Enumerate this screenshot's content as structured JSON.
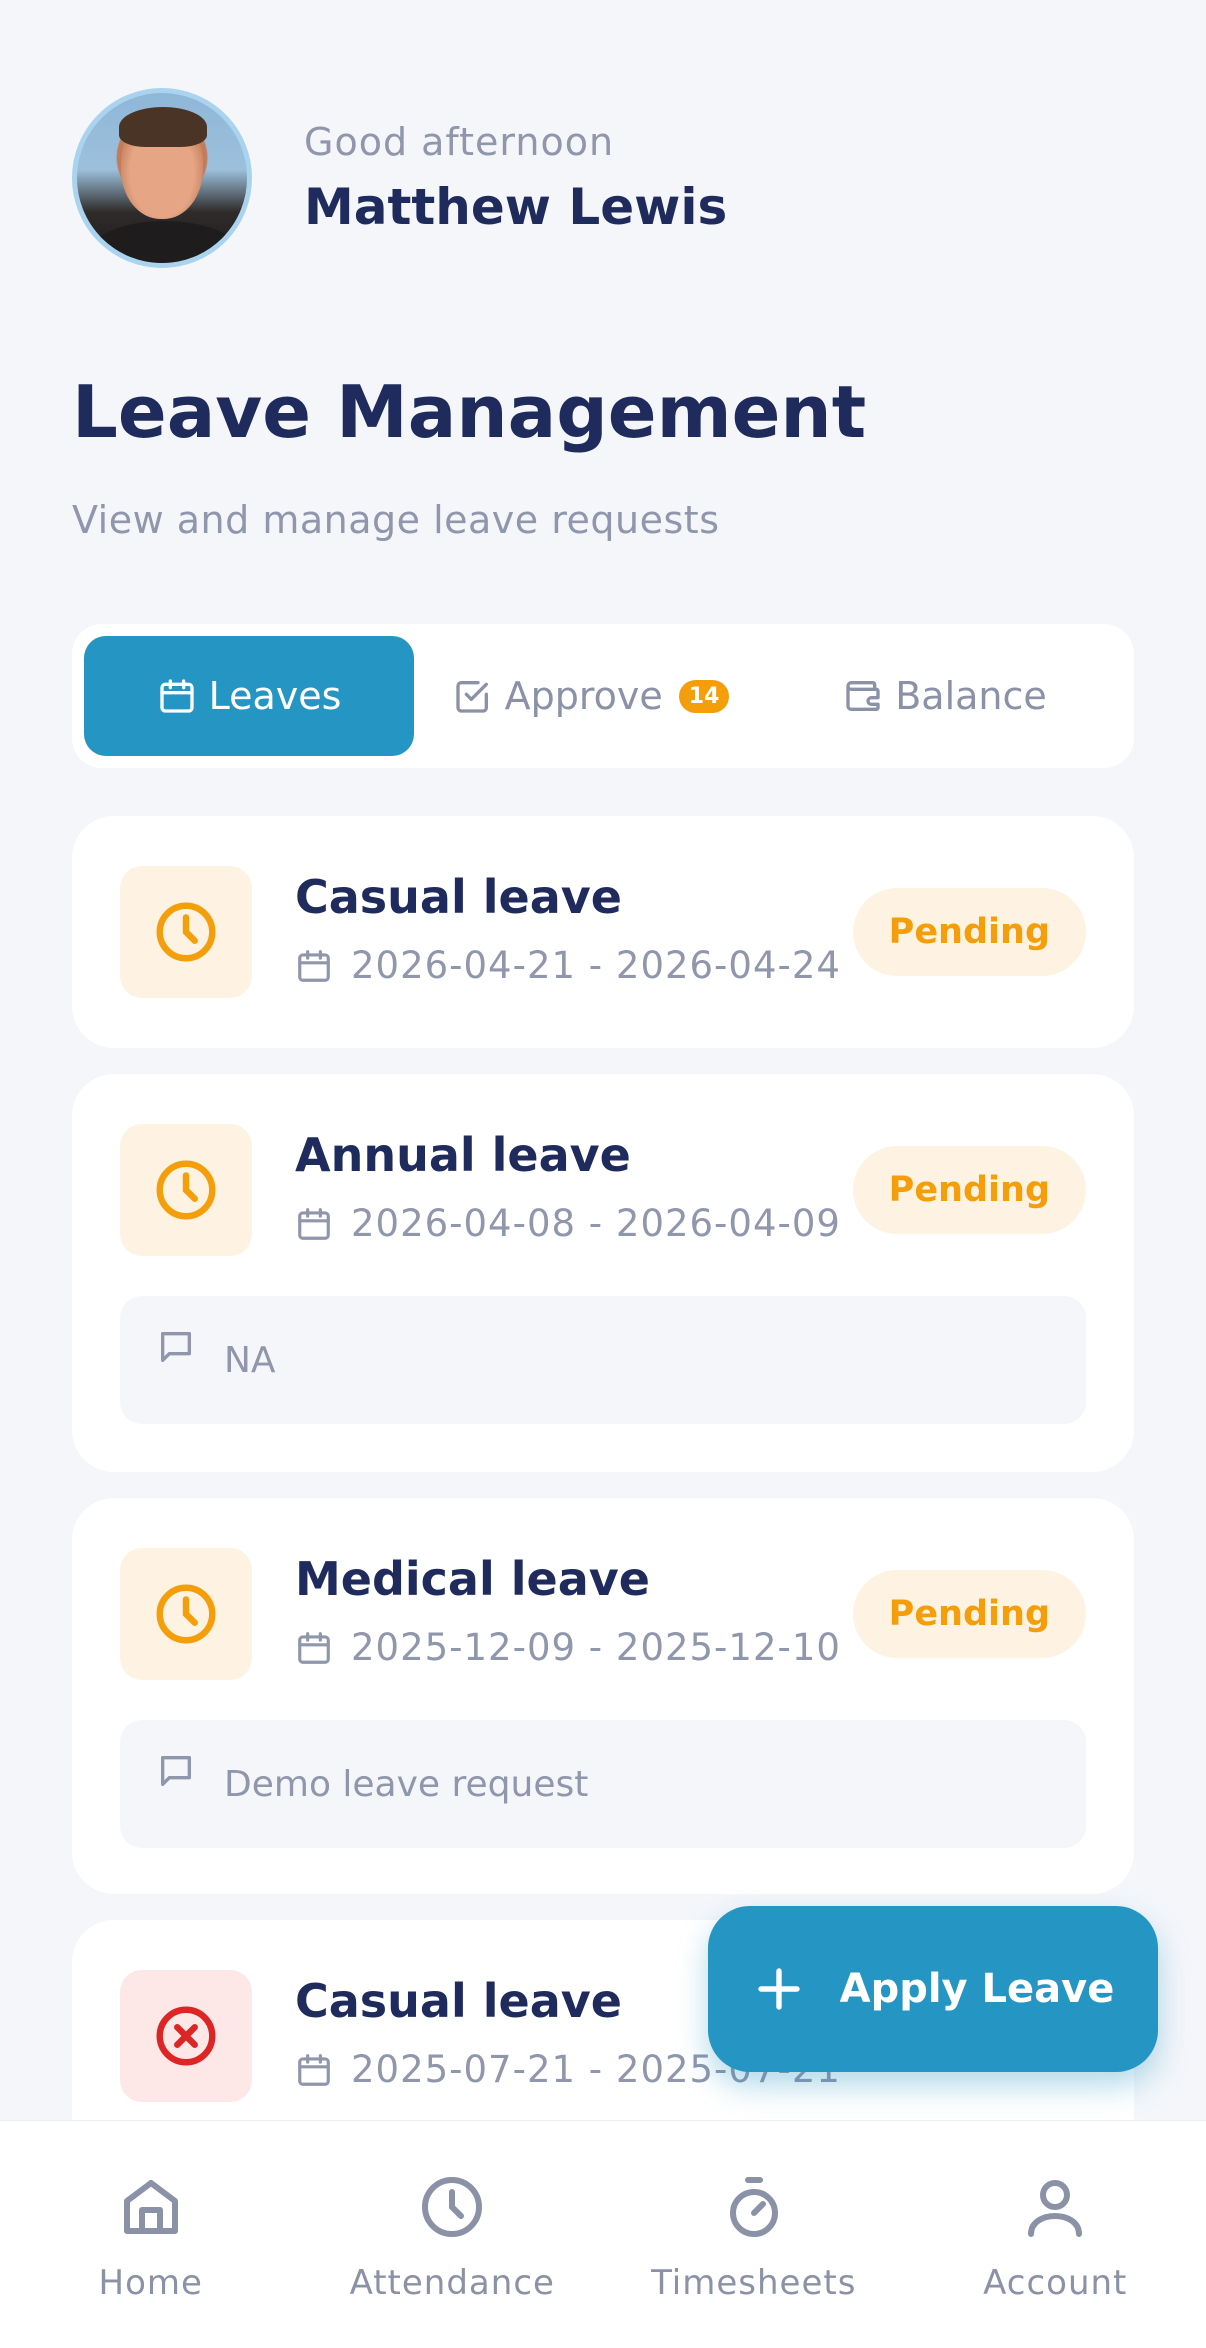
{
  "header": {
    "greeting": "Good afternoon",
    "user_name": "Matthew Lewis"
  },
  "page": {
    "title": "Leave Management",
    "subtitle": "View and manage leave requests"
  },
  "tabs": [
    {
      "label": "Leaves",
      "icon": "calendar-icon",
      "active": true
    },
    {
      "label": "Approve",
      "icon": "checkbox-icon",
      "badge": "14",
      "active": false
    },
    {
      "label": "Balance",
      "icon": "wallet-icon",
      "active": false
    }
  ],
  "leaves": [
    {
      "type": "Casual leave",
      "dates": "2026-04-21 - 2026-04-24",
      "status": "Pending",
      "note": ""
    },
    {
      "type": "Annual leave",
      "dates": "2026-04-08 - 2026-04-09",
      "status": "Pending",
      "note": "NA"
    },
    {
      "type": "Medical leave",
      "dates": "2025-12-09 - 2025-12-10",
      "status": "Pending",
      "note": "Demo leave request"
    },
    {
      "type": "Casual leave",
      "dates": "2025-07-21 - 2025-07-21",
      "status": "Rejected",
      "note": ""
    }
  ],
  "fab": {
    "label": "Apply Leave"
  },
  "nav": [
    {
      "label": "Home",
      "icon": "home-icon"
    },
    {
      "label": "Attendance",
      "icon": "clock-icon"
    },
    {
      "label": "Timesheets",
      "icon": "stopwatch-icon"
    },
    {
      "label": "Account",
      "icon": "user-icon"
    }
  ],
  "colors": {
    "primary": "#2596c3",
    "pending": "#f59e0b",
    "rejected": "#dc2626",
    "title": "#1f2b5c",
    "muted": "#9096ab",
    "background": "#f4f6fa"
  }
}
